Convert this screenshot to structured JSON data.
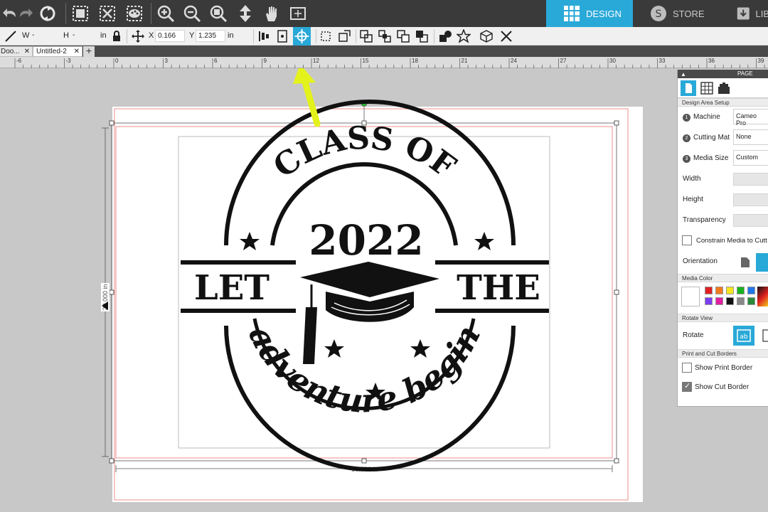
{
  "top_tabs": {
    "design": "DESIGN",
    "store": "STORE",
    "library": "LIB"
  },
  "toolbar_icons": [
    "undo-icon",
    "redo-icon",
    "refresh-icon",
    "group-icon",
    "ungroup-icon",
    "palette-icon",
    "zoom-in-icon",
    "zoom-out-icon",
    "zoom-select-icon",
    "move-icon",
    "pan-hand-icon",
    "fit-page-icon"
  ],
  "properties": {
    "w_label": "W",
    "w_value": "-",
    "h_label": "H",
    "h_value": "-",
    "size_unit": "in",
    "x_label": "X",
    "x_value": "0.166",
    "y_label": "Y",
    "y_value": "1.235",
    "pos_unit": "in"
  },
  "documents": {
    "tab1": "Doo...",
    "tab2": "Untitled-2",
    "add": "+"
  },
  "ruler": [
    "-6",
    "-3",
    "0",
    "3",
    "6",
    "9",
    "12",
    "15",
    "18",
    "21",
    "24",
    "27",
    "30",
    "33",
    "36",
    "39"
  ],
  "canvas": {
    "width_dimension": "30.000 in",
    "height_dimension": "20.000 in",
    "design": {
      "top_text": "CLASS OF",
      "year": "2022",
      "left_word": "LET",
      "right_word": "THE",
      "script_text": "adventure begin"
    }
  },
  "panel": {
    "title": "PAGE SETUP",
    "design_area_section": "Design Area Setup",
    "machine_label": "Machine",
    "machine_value": "Cameo Pro",
    "cutting_mat_label": "Cutting Mat",
    "cutting_mat_value": "None",
    "media_size_label": "Media Size",
    "media_size_value": "Custom",
    "width_label": "Width",
    "height_label": "Height",
    "transparency_label": "Transparency",
    "constrain_label": "Constrain Media to Cutt",
    "orientation_label": "Orientation",
    "media_color_section": "Media Color",
    "rotate_view_section": "Rotate View",
    "rotate_label": "Rotate",
    "print_cut_section": "Print and Cut Borders",
    "show_print_border_label": "Show Print Border",
    "show_print_border": false,
    "show_cut_border_label": "Show Cut Border",
    "show_cut_border": true,
    "media_colors": [
      "#e02020",
      "#f07c1e",
      "#f5e61e",
      "#18b31e",
      "#2277e8",
      "#7a3ef0",
      "#e01ea0",
      "#111111",
      "#888888",
      "#2a8a3a"
    ]
  },
  "colors": {
    "accent": "#29a9d8",
    "toolbar_bg": "#3a3a3a",
    "arrow": "#e4f21c",
    "cut_border": "#f08c8c"
  }
}
